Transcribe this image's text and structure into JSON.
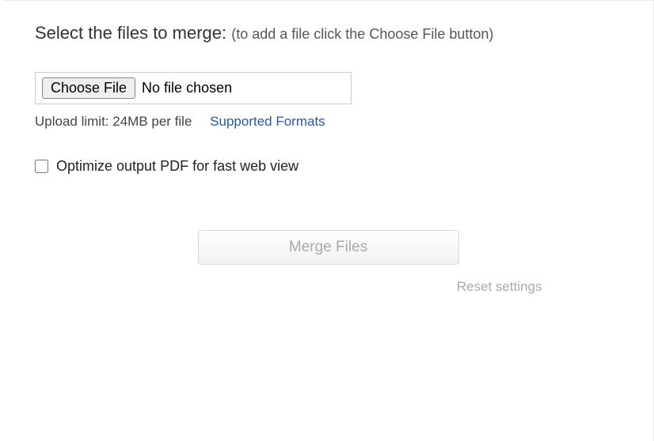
{
  "heading": {
    "main": "Select the files to merge: ",
    "hint": "(to add a file click the Choose File button)"
  },
  "file_input": {
    "button_label": "Choose File",
    "status_text": "No file chosen"
  },
  "info": {
    "upload_limit": "Upload limit: 24MB per file",
    "supported_link": "Supported Formats"
  },
  "option": {
    "label": "Optimize output PDF for fast web view",
    "checked": false
  },
  "actions": {
    "merge_label": "Merge Files",
    "reset_label": "Reset settings"
  }
}
